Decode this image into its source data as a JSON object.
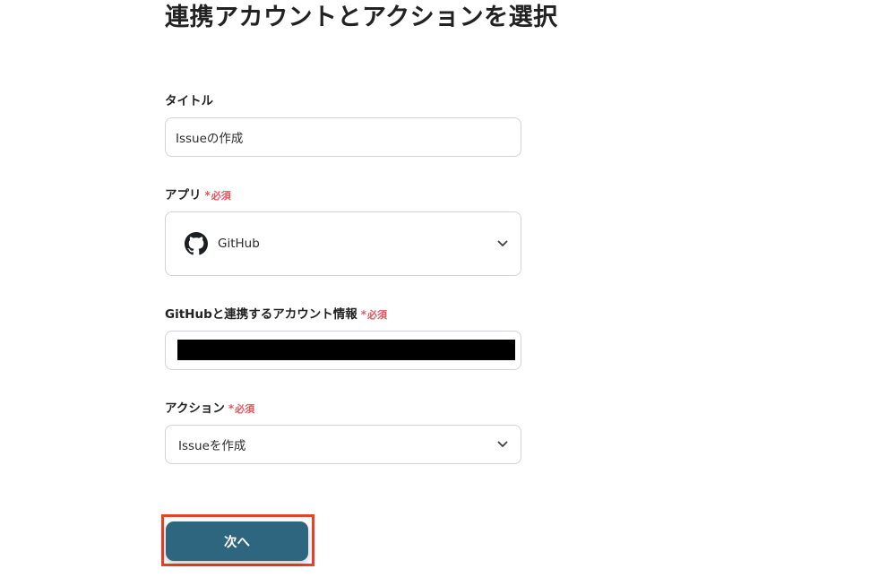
{
  "page": {
    "title": "連携アカウントとアクションを選択"
  },
  "required_label": "必須",
  "required_star": "*",
  "form": {
    "title_field": {
      "label": "タイトル",
      "value": "Issueの作成"
    },
    "app_field": {
      "label": "アプリ",
      "required": true,
      "selected": "GitHub",
      "icon": "github-icon"
    },
    "account_field": {
      "label": "GitHubと連携するアカウント情報",
      "required": true,
      "value_redacted": true
    },
    "action_field": {
      "label": "アクション",
      "required": true,
      "selected": "Issueを作成"
    }
  },
  "next_button": {
    "label": "次へ",
    "color": "#2e6680",
    "highlight_color": "#e8402a"
  },
  "colors": {
    "required": "#e0565b",
    "border": "#d0d3d7"
  }
}
